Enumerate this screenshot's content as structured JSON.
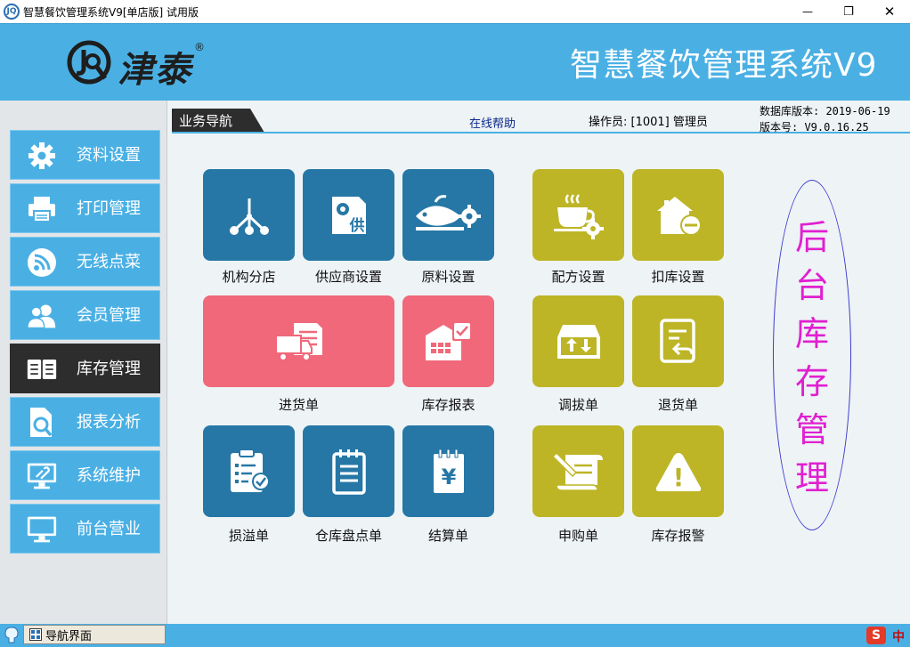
{
  "window": {
    "app_icon_text": "JQ",
    "title": "智慧餐饮管理系统V9[单店版]  试用版",
    "minimize": "—",
    "maximize": "❐",
    "close": "✕"
  },
  "header": {
    "brand": "津泰",
    "brand_mark": "®",
    "system_title": "智慧餐饮管理系统V9"
  },
  "sidebar": {
    "items": [
      {
        "label": "资料设置",
        "icon": "gear-icon"
      },
      {
        "label": "打印管理",
        "icon": "printer-icon"
      },
      {
        "label": "无线点菜",
        "icon": "wifi-icon"
      },
      {
        "label": "会员管理",
        "icon": "users-icon"
      },
      {
        "label": "库存管理",
        "icon": "book-icon",
        "active": true
      },
      {
        "label": "报表分析",
        "icon": "report-search-icon"
      },
      {
        "label": "系统维护",
        "icon": "monitor-settings-icon"
      },
      {
        "label": "前台营业",
        "icon": "monitor-icon"
      }
    ]
  },
  "main": {
    "tab_label": "业务导航",
    "help_link": "在线帮助",
    "operator": "操作员: [1001] 管理员",
    "db_version": "数据库版本: 2019-06-19",
    "app_version": "版本号: V9.0.16.25",
    "tiles": [
      {
        "label": "机构分店",
        "icon": "org-tree-icon"
      },
      {
        "label": "供应商设置",
        "icon": "supplier-icon",
        "glyph": "供"
      },
      {
        "label": "原料设置",
        "icon": "fish-gear-icon"
      },
      {
        "label": "配方设置",
        "icon": "cup-gear-icon"
      },
      {
        "label": "扣库设置",
        "icon": "house-minus-icon"
      },
      {
        "label": "进货单",
        "icon": "truck-doc-icon"
      },
      {
        "label": "库存报表",
        "icon": "warehouse-report-icon"
      },
      {
        "label": "调拔单",
        "icon": "transfer-box-icon"
      },
      {
        "label": "退货单",
        "icon": "return-doc-icon"
      },
      {
        "label": "损溢单",
        "icon": "clipboard-check-icon"
      },
      {
        "label": "仓库盘点单",
        "icon": "notepad-icon"
      },
      {
        "label": "结算单",
        "icon": "yen-doc-icon",
        "glyph": "¥"
      },
      {
        "label": "申购单",
        "icon": "scroll-pen-icon"
      },
      {
        "label": "库存报警",
        "icon": "warning-icon",
        "glyph": "!"
      }
    ],
    "section_title": "后台库存管理"
  },
  "taskbar": {
    "task_label": "导航界面",
    "ime_logo": "S",
    "ime_lang": "中"
  },
  "colors": {
    "header_blue": "#4ab0e4",
    "tile_blue": "#2677a6",
    "tile_olive": "#bdb526",
    "tile_pink": "#f0687a",
    "active_nav": "#2d2d2d",
    "section_title": "#e020d0"
  }
}
